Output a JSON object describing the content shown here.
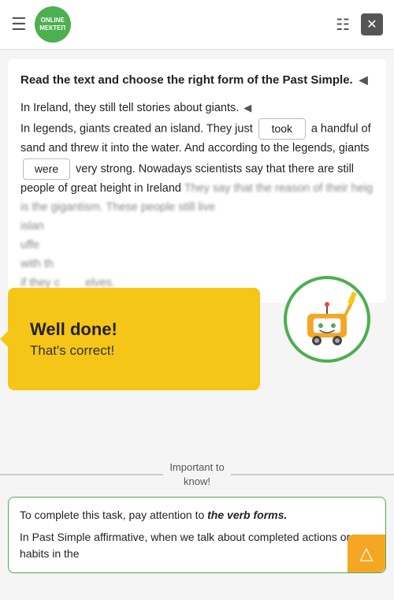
{
  "header": {
    "logo_line1": "ONLINE",
    "logo_line2": "МЕКТЕП",
    "close_label": "✕"
  },
  "instruction": {
    "text": "Read the text and choose the right form of the Past Simple.",
    "audio_icon": "◀"
  },
  "text_body": {
    "para1": "In Ireland, they still tell stories about giants.",
    "audio_inline": "◀",
    "para2": "In legends, giants created an island. They just",
    "answer1": "took",
    "para3": "a handful of sand and threw it into the water. And according to the legends, giants",
    "answer2": "were",
    "para4": "very strong. Nowadays scientists say that there are still people of great height in Ireland",
    "blurred1": "They say that the reason of their heig",
    "blurred2": "is the gigantism. These people still live",
    "blurred3": "islan",
    "blurred4": "uffe",
    "blurred5": "with th",
    "blurred6": "if they c",
    "blurred7": "elves."
  },
  "well_done": {
    "title": "Well done!",
    "subtitle": "That's correct!"
  },
  "divider": {
    "label": "Important to\nknow!"
  },
  "info_box": {
    "line1": "To complete this task, pay attention to ",
    "line1_bold": "the verb forms.",
    "line2": "In Past Simple affirmative, when we talk about completed actions or habits in the"
  }
}
